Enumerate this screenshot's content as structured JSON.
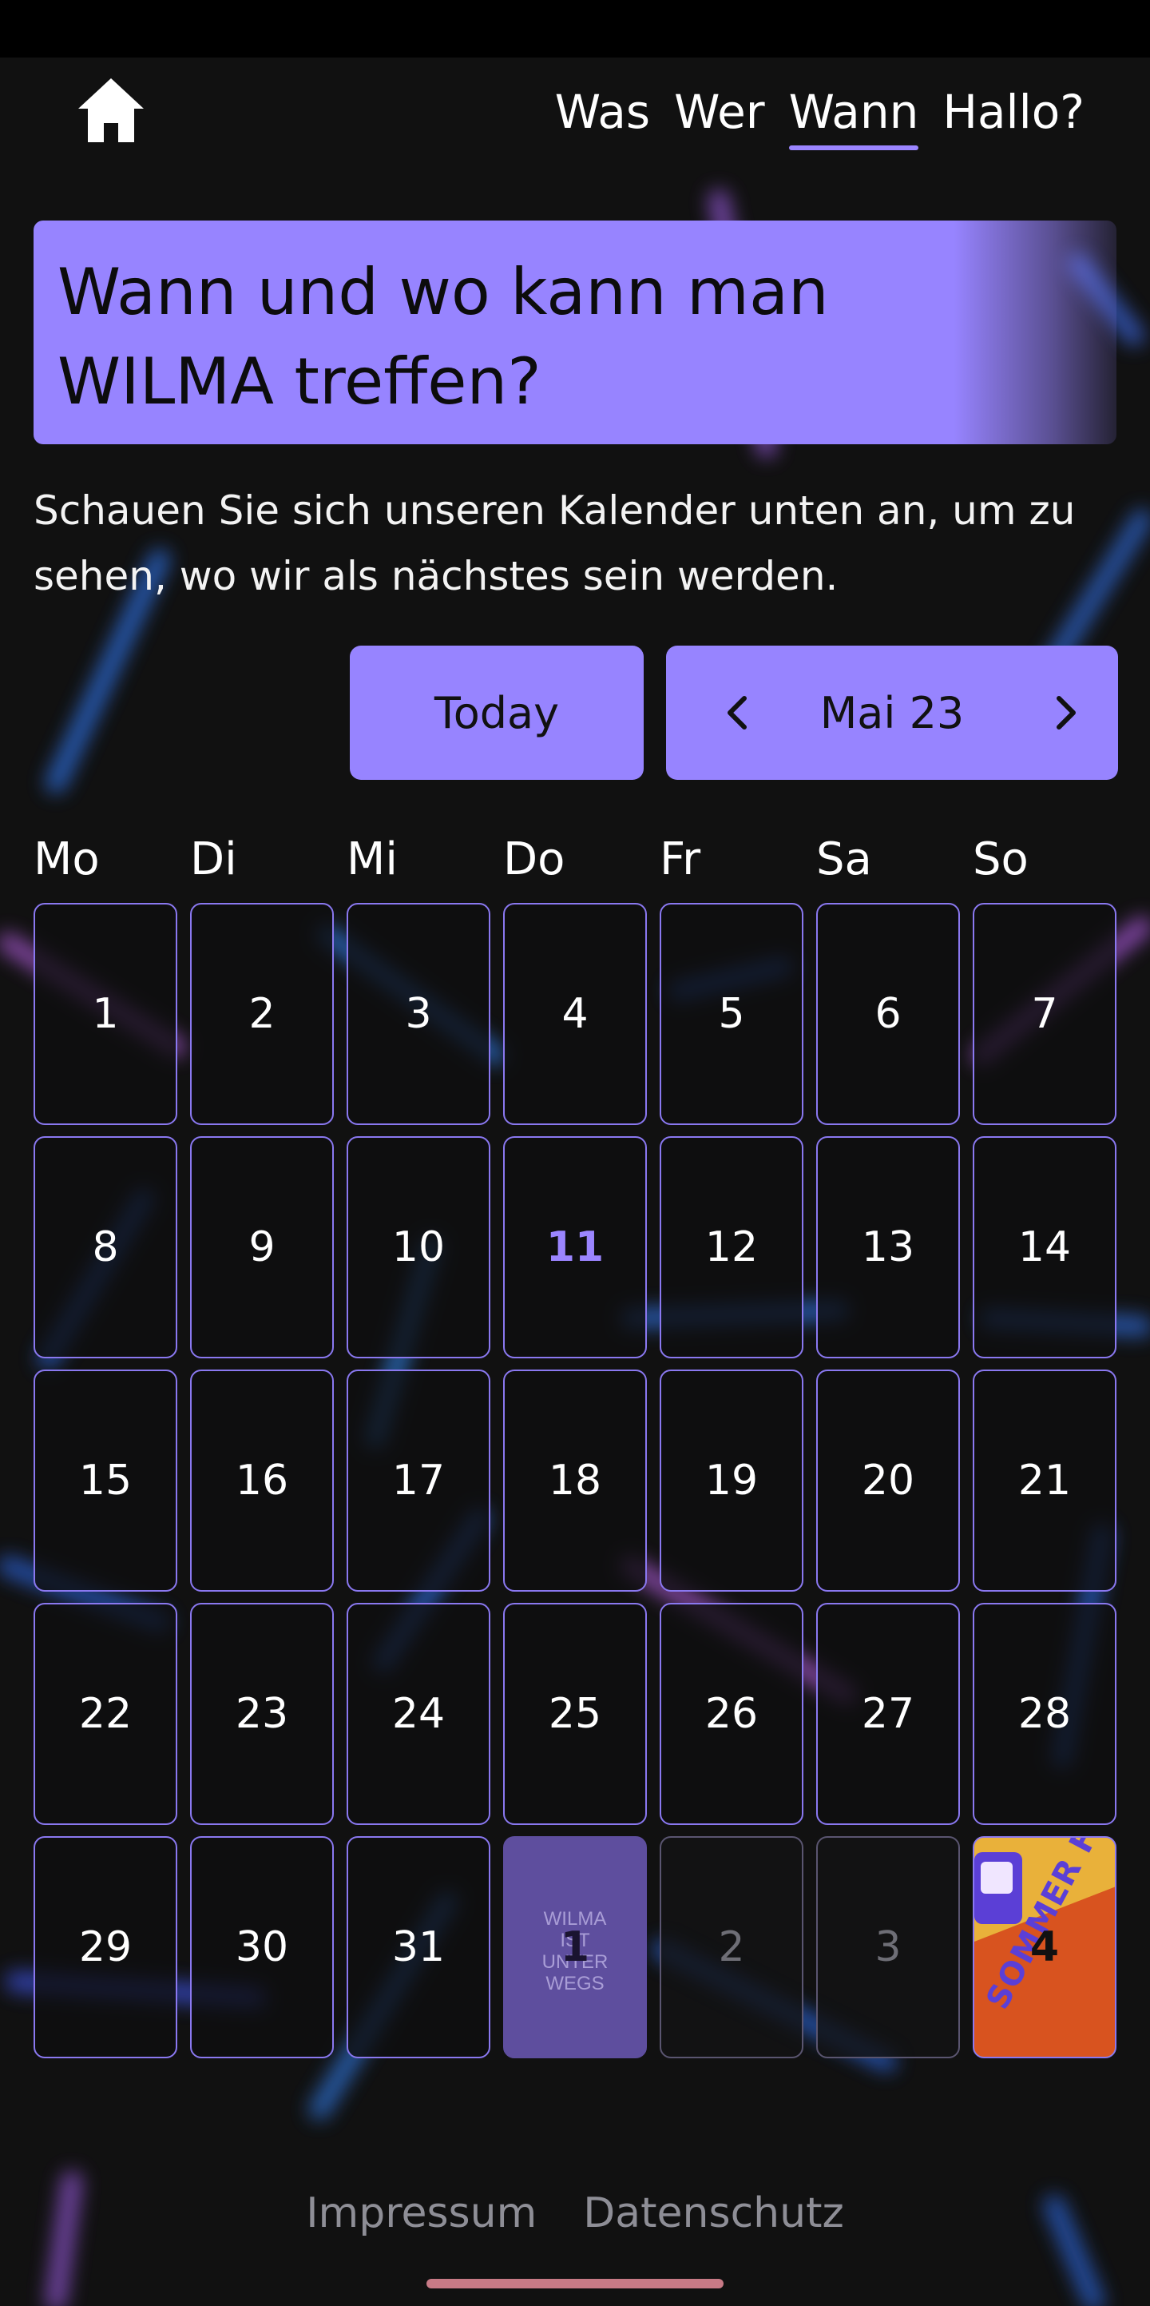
{
  "nav": {
    "home_icon": "home-icon",
    "items": [
      {
        "label": "Was",
        "active": false
      },
      {
        "label": "Wer",
        "active": false
      },
      {
        "label": "Wann",
        "active": true
      },
      {
        "label": "Hallo?",
        "active": false
      }
    ]
  },
  "hero": {
    "title": "Wann und wo kann man WILMA treffen?"
  },
  "intro": "Schauen Sie sich unseren Kalender unten an, um zu sehen, wo wir als nächstes sein werden.",
  "calendar": {
    "today_label": "Today",
    "month_label": "Mai 23",
    "prev_icon": "chevron-left-icon",
    "next_icon": "chevron-right-icon",
    "weekdays": [
      "Mo",
      "Di",
      "Mi",
      "Do",
      "Fr",
      "Sa",
      "So"
    ],
    "days": [
      "1",
      "2",
      "3",
      "4",
      "5",
      "6",
      "7",
      "8",
      "9",
      "10",
      "11",
      "12",
      "13",
      "14",
      "15",
      "16",
      "17",
      "18",
      "19",
      "20",
      "21",
      "22",
      "23",
      "24",
      "25",
      "26",
      "27",
      "28",
      "29",
      "30",
      "31",
      "1",
      "2",
      "3",
      "4"
    ],
    "today_day": "11",
    "events": {
      "wilma_unterwegs": "WILMA\nIST\nUNTER\nWEGS",
      "sommerfest": "SOMMER FEST"
    }
  },
  "footer": {
    "impressum": "Impressum",
    "datenschutz": "Datenschutz"
  },
  "colors": {
    "accent": "#9784ff",
    "background": "#111111",
    "cell_border": "#8a78f0"
  }
}
